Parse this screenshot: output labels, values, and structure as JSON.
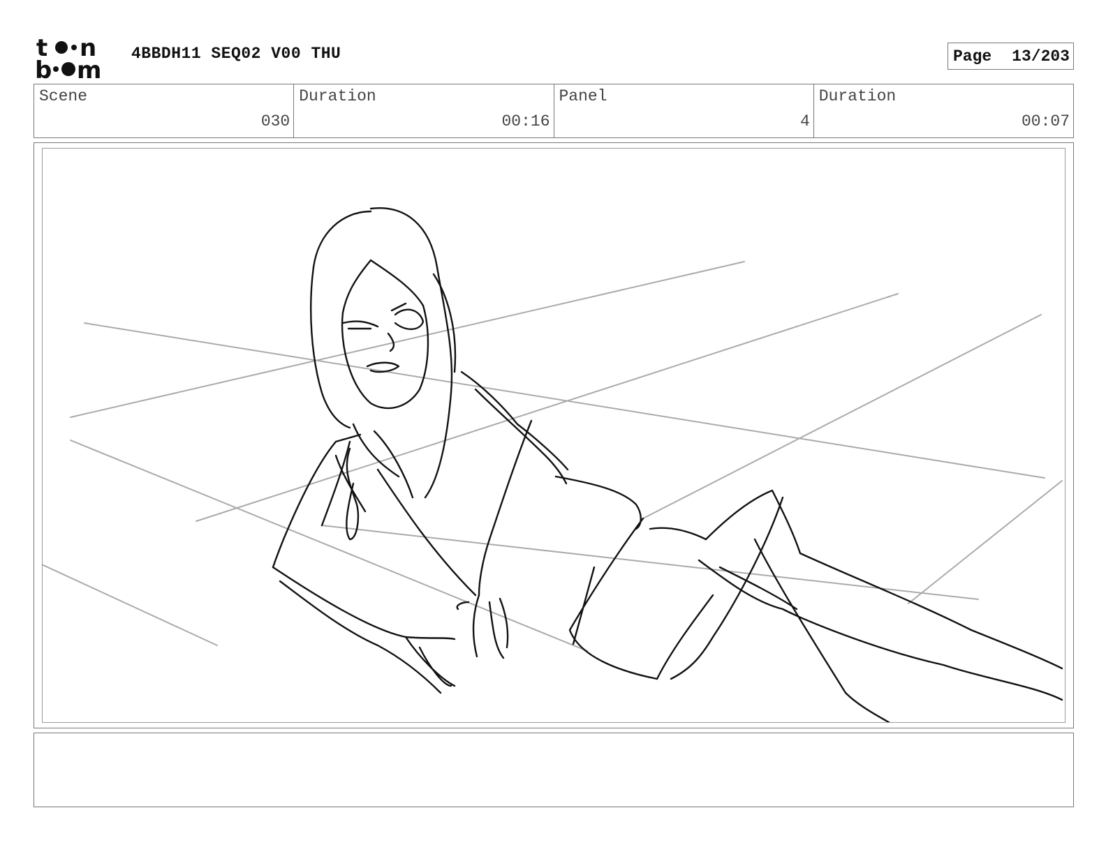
{
  "header": {
    "logo_text": "toon boom",
    "title": "4BBDH11 SEQ02 V00 THU",
    "page_label": "Page",
    "page_value": "13/203"
  },
  "info": {
    "scene_label": "Scene",
    "scene_value": "030",
    "duration1_label": "Duration",
    "duration1_value": "00:16",
    "panel_label": "Panel",
    "panel_value": "4",
    "duration2_label": "Duration",
    "duration2_value": "00:07"
  },
  "panel": {
    "image": "storyboard-sketch-girl-lying-on-floor"
  },
  "notes": {
    "text": ""
  }
}
